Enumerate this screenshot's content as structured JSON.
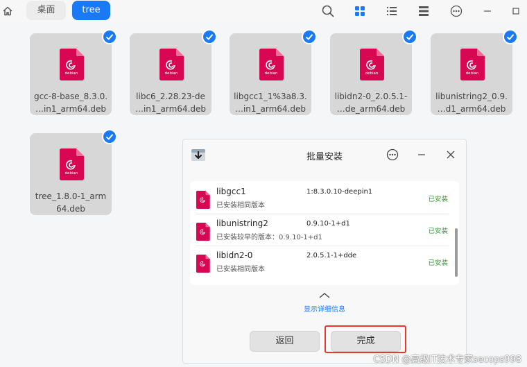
{
  "toolbar": {
    "path": [
      "桌面",
      "tree"
    ],
    "icons": [
      "home-icon",
      "search-icon",
      "icon-view-icon",
      "list-view-icon",
      "detail-view-icon",
      "more-icon",
      "minimize-icon",
      "maximize-icon"
    ]
  },
  "files": [
    {
      "line1": "gcc-8-base_8.3.0.",
      "line2": "…in1_arm64.deb",
      "selected": true
    },
    {
      "line1": "libc6_2.28.23-de",
      "line2": "…in1_arm64.deb",
      "selected": true
    },
    {
      "line1": "libgcc1_1%3a8.3.",
      "line2": "…in1_arm64.deb",
      "selected": true
    },
    {
      "line1": "libidn2-0_2.0.5.1-",
      "line2": "…de_arm64.deb",
      "selected": true
    },
    {
      "line1": "libunistring2_0.9.",
      "line2": "…d1_arm64.deb",
      "selected": true
    },
    {
      "line1": "tree_1.8.0-1_arm",
      "line2": "64.deb",
      "selected": true
    }
  ],
  "icon_label": "debian",
  "colors": {
    "accent": "#1a79f5",
    "debian": "#d70751",
    "installed": "#2e9e2e",
    "highlight": "#e8362c"
  },
  "dialog": {
    "title": "批量安装",
    "packages": [
      {
        "name": "libgcc1",
        "desc": "已安装相同版本",
        "old_version": "",
        "version": "1:8.3.0.10-deepin1",
        "status": "已安装"
      },
      {
        "name": "libunistring2",
        "desc": "已安装较早的版本：",
        "old_version": "0.9.10-1+d1",
        "version": "0.9.10-1+d1",
        "status": "已安装"
      },
      {
        "name": "libidn2-0",
        "desc": "已安装相同版本",
        "old_version": "",
        "version": "2.0.5.1-1+dde",
        "status": "已安装"
      }
    ],
    "detail_link": "显示详细信息",
    "back_label": "返回",
    "done_label": "完成"
  },
  "watermark": "CSDN @高级IT技术专家secops998"
}
